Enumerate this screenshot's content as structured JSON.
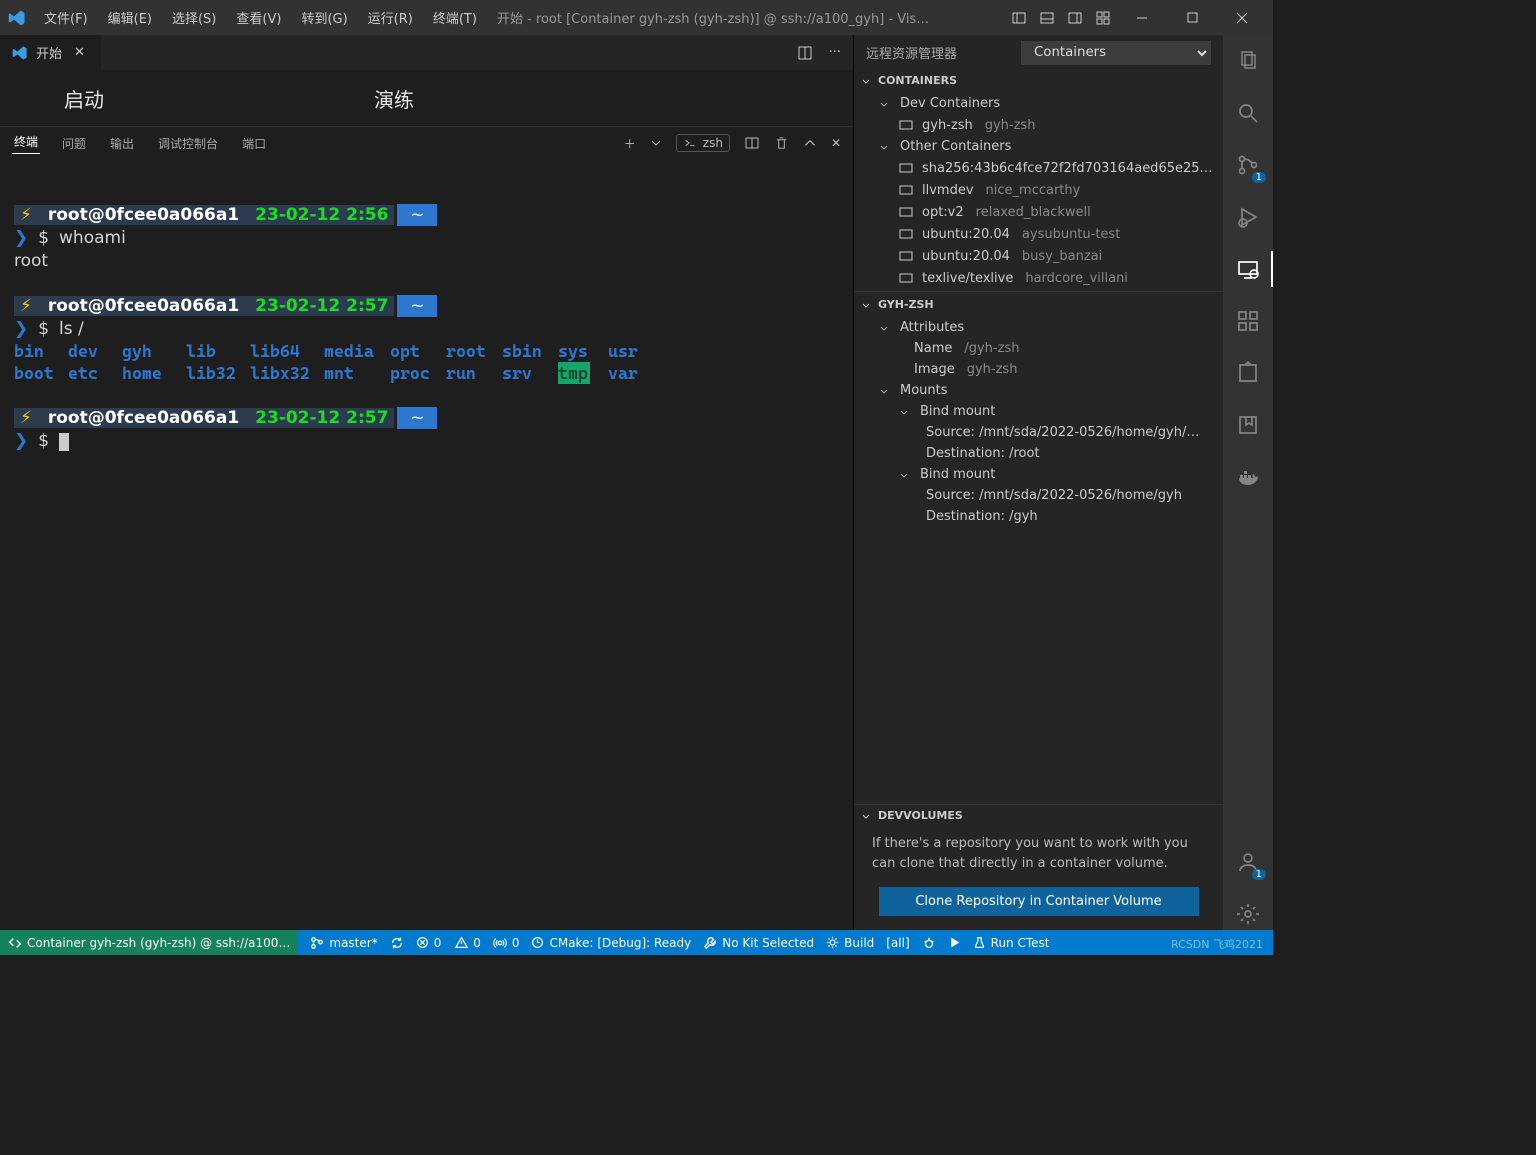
{
  "titlebar": {
    "menus": [
      "文件(F)",
      "编辑(E)",
      "选择(S)",
      "查看(V)",
      "转到(G)",
      "运行(R)",
      "终端(T)"
    ],
    "title": "开始 - root [Container gyh-zsh (gyh-zsh)] @ ssh://a100_gyh] - Vis…"
  },
  "tab": {
    "label": "开始"
  },
  "welcome": {
    "col1": "启动",
    "col2": "演练"
  },
  "panel": {
    "tabs": [
      "终端",
      "问题",
      "输出",
      "调试控制台",
      "端口"
    ],
    "shell": "zsh"
  },
  "terminal": {
    "prompt1": {
      "host": "root@0fcee0a066a1",
      "dt": "23-02-12 2:56",
      "dir": "~",
      "cmd": "whoami"
    },
    "out1": "root",
    "prompt2": {
      "host": "root@0fcee0a066a1",
      "dt": "23-02-12 2:57",
      "dir": "~",
      "cmd": "ls /"
    },
    "ls": {
      "row1": [
        "bin",
        "dev",
        "gyh",
        "lib",
        "lib64",
        "media",
        "opt",
        "root",
        "sbin",
        "sys",
        "usr"
      ],
      "row2": [
        "boot",
        "etc",
        "home",
        "lib32",
        "libx32",
        "mnt",
        "proc",
        "run",
        "srv",
        "tmp",
        "var"
      ]
    },
    "prompt3": {
      "host": "root@0fcee0a066a1",
      "dt": "23-02-12 2:57",
      "dir": "~"
    },
    "dollar": "$",
    "arrow": "❯"
  },
  "side": {
    "title": "远程资源管理器",
    "dropdown": "Containers",
    "sec_containers": "CONTAINERS",
    "dev_label": "Dev Containers",
    "dev": [
      {
        "n": "gyh-zsh",
        "s": "gyh-zsh"
      }
    ],
    "other_label": "Other Containers",
    "other": [
      {
        "n": "sha256:43b6c4fce72f2fd703164aed65e25…",
        "s": ""
      },
      {
        "n": "llvmdev",
        "s": "nice_mccarthy"
      },
      {
        "n": "opt:v2",
        "s": "relaxed_blackwell"
      },
      {
        "n": "ubuntu:20.04",
        "s": "aysubuntu-test"
      },
      {
        "n": "ubuntu:20.04",
        "s": "busy_banzai"
      },
      {
        "n": "texlive/texlive",
        "s": "hardcore_villani"
      }
    ],
    "sec_sel": "GYH-ZSH",
    "attr_label": "Attributes",
    "attrs": [
      {
        "k": "Name",
        "v": "/gyh-zsh"
      },
      {
        "k": "Image",
        "v": "gyh-zsh"
      }
    ],
    "mounts_label": "Mounts",
    "mounts": [
      {
        "t": "Bind mount",
        "src": "Source: /mnt/sda/2022-0526/home/gyh/…",
        "dst": "Destination: /root"
      },
      {
        "t": "Bind mount",
        "src": "Source: /mnt/sda/2022-0526/home/gyh",
        "dst": "Destination: /gyh"
      }
    ],
    "sec_vol": "DEVVOLUMES",
    "vol_msg": "If there's a repository you want to work with you can clone that directly in a container volume.",
    "vol_btn": "Clone Repository in Container Volume"
  },
  "status": {
    "remote": "Container gyh-zsh (gyh-zsh) @ ssh://a100…",
    "branch": "master*",
    "errors": "0",
    "warns": "0",
    "ports": "0",
    "cmake": "CMake: [Debug]: Ready",
    "kit": "No Kit Selected",
    "build": "Build",
    "all": "[all]",
    "run": "Run CTest"
  },
  "watermark": "RCSDN 飞鸡2021"
}
